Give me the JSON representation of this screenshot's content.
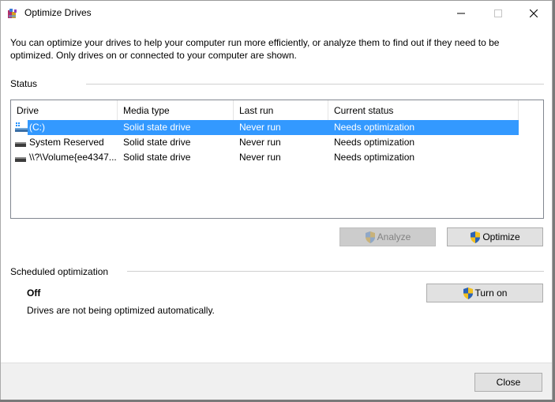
{
  "window": {
    "title": "Optimize Drives",
    "controls": {
      "minimize": "minimize",
      "maximize": "maximize",
      "close": "close"
    }
  },
  "intro_text": "You can optimize your drives to help your computer run more efficiently, or analyze them to find out if they need to be optimized. Only drives on or connected to your computer are shown.",
  "status": {
    "label": "Status",
    "columns": [
      "Drive",
      "Media type",
      "Last run",
      "Current status"
    ],
    "rows": [
      {
        "icon": "windows-drive-icon",
        "drive": "(C:)",
        "media_type": "Solid state drive",
        "last_run": "Never run",
        "current_status": "Needs optimization",
        "selected": true
      },
      {
        "icon": "hard-drive-icon",
        "drive": "System Reserved",
        "media_type": "Solid state drive",
        "last_run": "Never run",
        "current_status": "Needs optimization",
        "selected": false
      },
      {
        "icon": "hard-drive-icon",
        "drive": "\\\\?\\Volume{ee4347...",
        "media_type": "Solid state drive",
        "last_run": "Never run",
        "current_status": "Needs optimization",
        "selected": false
      }
    ],
    "buttons": {
      "analyze": {
        "label": "Analyze",
        "enabled": false,
        "icon": "uac-shield-icon"
      },
      "optimize": {
        "label": "Optimize",
        "enabled": true,
        "icon": "uac-shield-icon"
      }
    }
  },
  "scheduled": {
    "label": "Scheduled optimization",
    "state": "Off",
    "description": "Drives are not being optimized automatically.",
    "turn_on_label": "Turn on"
  },
  "footer": {
    "close_label": "Close"
  },
  "colors": {
    "selection": "#3399ff",
    "button_bg": "#e1e1e1",
    "footer_bg": "#f0f0f0"
  }
}
